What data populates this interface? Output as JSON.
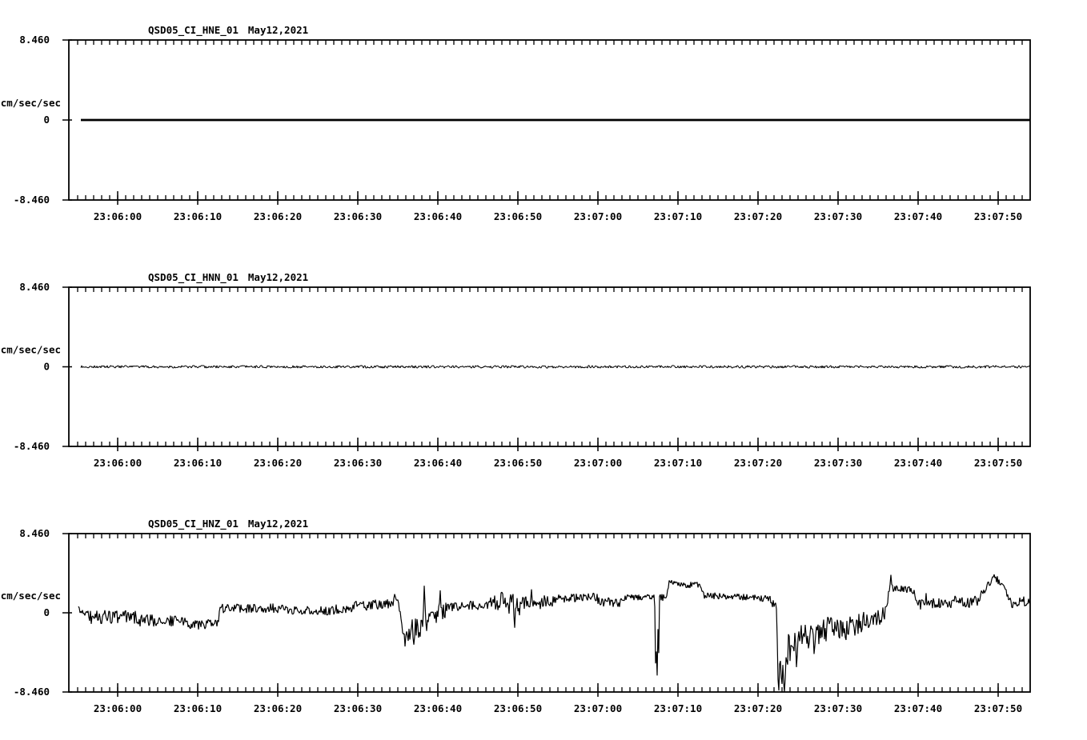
{
  "page": {
    "background": "#ffffff"
  },
  "chart_data": {
    "type": "line",
    "kind": "seismogram-multipanel",
    "colors": {
      "trace": "#000000",
      "axis": "#000000",
      "text": "#000000",
      "background": "#ffffff"
    },
    "y_axis": {
      "unit_label": "cm/sec/sec",
      "tick_labels": [
        "8.460",
        "0",
        "-8.460"
      ],
      "tick_values": [
        8.46,
        0,
        -8.46
      ],
      "ylim": [
        -8.46,
        8.46
      ]
    },
    "x_axis": {
      "tick_labels": [
        "23:06:00",
        "23:06:10",
        "23:06:20",
        "23:06:30",
        "23:06:40",
        "23:06:50",
        "23:07:00",
        "23:07:10",
        "23:07:20",
        "23:07:30",
        "23:07:40",
        "23:07:50"
      ],
      "minor_tick_interval_seconds": 1,
      "major_tick_interval_seconds": 10,
      "grid": false
    },
    "legend": null,
    "panels": [
      {
        "station_channel": "QSD05_CI_HNE_01",
        "date": "May12,2021",
        "trace": {
          "stroke_width": 2.8,
          "t_start": 1.4,
          "t_end": 120,
          "segments": [
            [
              1.4,
              120,
              0,
              0,
              0
            ]
          ],
          "spikes": []
        }
      },
      {
        "station_channel": "QSD05_CI_HNN_01",
        "date": "May12,2021",
        "trace": {
          "stroke_width": 1.0,
          "t_start": 1.4,
          "t_end": 120,
          "segments": [
            [
              1.4,
              120,
              0,
              0,
              0.14
            ]
          ],
          "spikes": []
        }
      },
      {
        "station_channel": "QSD05_CI_HNZ_01",
        "date": "May12,2021",
        "trace": {
          "stroke_width": 1.2,
          "t_start": 1.1,
          "t_end": 120,
          "segments": [
            [
              1.1,
              2.4,
              0.2,
              0.0,
              0.55
            ],
            [
              2.4,
              8.5,
              -0.45,
              -0.5,
              0.75
            ],
            [
              8.5,
              14.5,
              -0.8,
              -0.9,
              0.65
            ],
            [
              14.5,
              18.7,
              -1.2,
              -1.3,
              0.55
            ],
            [
              18.7,
              26.8,
              0.45,
              0.5,
              0.5
            ],
            [
              26.8,
              33.3,
              0.25,
              0.2,
              0.5
            ],
            [
              33.3,
              39.3,
              0.5,
              0.9,
              0.6
            ],
            [
              39.3,
              41.2,
              0.9,
              1.1,
              0.5
            ],
            [
              41.2,
              41.7,
              0.8,
              -2.3,
              0.7
            ],
            [
              41.7,
              44.0,
              -2.0,
              -1.8,
              1.3
            ],
            [
              44.0,
              47.0,
              -1.4,
              0.3,
              0.9
            ],
            [
              47.0,
              52.6,
              0.6,
              0.9,
              0.5
            ],
            [
              52.6,
              57.0,
              1.0,
              0.9,
              1.2
            ],
            [
              57.0,
              60.5,
              1.0,
              1.2,
              0.75
            ],
            [
              60.5,
              66.0,
              1.5,
              1.7,
              0.45
            ],
            [
              66.0,
              69.0,
              1.2,
              1.1,
              0.5
            ],
            [
              69.0,
              73.1,
              1.6,
              1.75,
              0.35
            ],
            [
              73.1,
              73.7,
              1.6,
              1.6,
              0.45
            ],
            [
              73.7,
              74.6,
              1.6,
              1.7,
              0.4
            ],
            [
              74.6,
              74.9,
              1.9,
              3.35,
              0.2
            ],
            [
              74.9,
              77.6,
              3.3,
              2.85,
              0.25
            ],
            [
              77.6,
              78.9,
              3.0,
              3.0,
              0.3
            ],
            [
              78.9,
              79.3,
              2.6,
              1.95,
              0.2
            ],
            [
              79.3,
              85.0,
              1.85,
              1.65,
              0.35
            ],
            [
              85.0,
              87.6,
              1.6,
              1.5,
              0.35
            ],
            [
              87.6,
              88.4,
              1.2,
              0.4,
              0.6
            ],
            [
              88.4,
              89.6,
              -4.5,
              -5.0,
              2.6
            ],
            [
              89.6,
              90.3,
              -4.2,
              -3.6,
              1.8
            ],
            [
              90.3,
              92.0,
              -3.4,
              -2.0,
              1.4
            ],
            [
              92.0,
              95.5,
              -2.4,
              -1.8,
              1.5
            ],
            [
              95.5,
              99.0,
              -1.7,
              -1.2,
              1.2
            ],
            [
              99.0,
              102.0,
              -0.9,
              -0.2,
              1.0
            ],
            [
              102.0,
              102.4,
              0.3,
              2.6,
              0.4
            ],
            [
              102.4,
              105.6,
              2.6,
              2.4,
              0.4
            ],
            [
              105.6,
              106.0,
              1.6,
              0.9,
              0.3
            ],
            [
              106.0,
              110.0,
              0.9,
              1.0,
              0.6
            ],
            [
              110.0,
              113.5,
              1.1,
              1.3,
              0.7
            ],
            [
              113.5,
              115.3,
              1.4,
              3.8,
              0.5
            ],
            [
              115.3,
              116.2,
              3.9,
              3.3,
              0.45
            ],
            [
              116.2,
              117.6,
              3.2,
              1.3,
              0.4
            ],
            [
              117.6,
              120.0,
              1.0,
              1.3,
              0.55
            ]
          ],
          "spikes": [
            [
              40.6,
              2.0,
              0.15
            ],
            [
              41.9,
              -3.6,
              0.2
            ],
            [
              43.0,
              -3.4,
              0.2
            ],
            [
              44.3,
              2.9,
              0.18
            ],
            [
              46.3,
              2.4,
              0.18
            ],
            [
              54.0,
              2.2,
              0.15
            ],
            [
              55.6,
              -1.6,
              0.15
            ],
            [
              57.7,
              2.5,
              0.15
            ],
            [
              73.2,
              -5.4,
              0.12
            ],
            [
              73.35,
              -6.7,
              0.14
            ],
            [
              73.55,
              -4.3,
              0.12
            ],
            [
              88.6,
              -8.3,
              0.18
            ],
            [
              88.95,
              -7.6,
              0.15
            ],
            [
              89.3,
              -8.45,
              0.3
            ],
            [
              90.8,
              -5.8,
              0.15
            ],
            [
              93.0,
              -4.4,
              0.15
            ],
            [
              97.0,
              -2.9,
              0.12
            ],
            [
              102.6,
              4.05,
              0.18
            ],
            [
              107.0,
              2.1,
              0.12
            ],
            [
              115.5,
              4.1,
              0.15
            ]
          ]
        }
      }
    ]
  }
}
